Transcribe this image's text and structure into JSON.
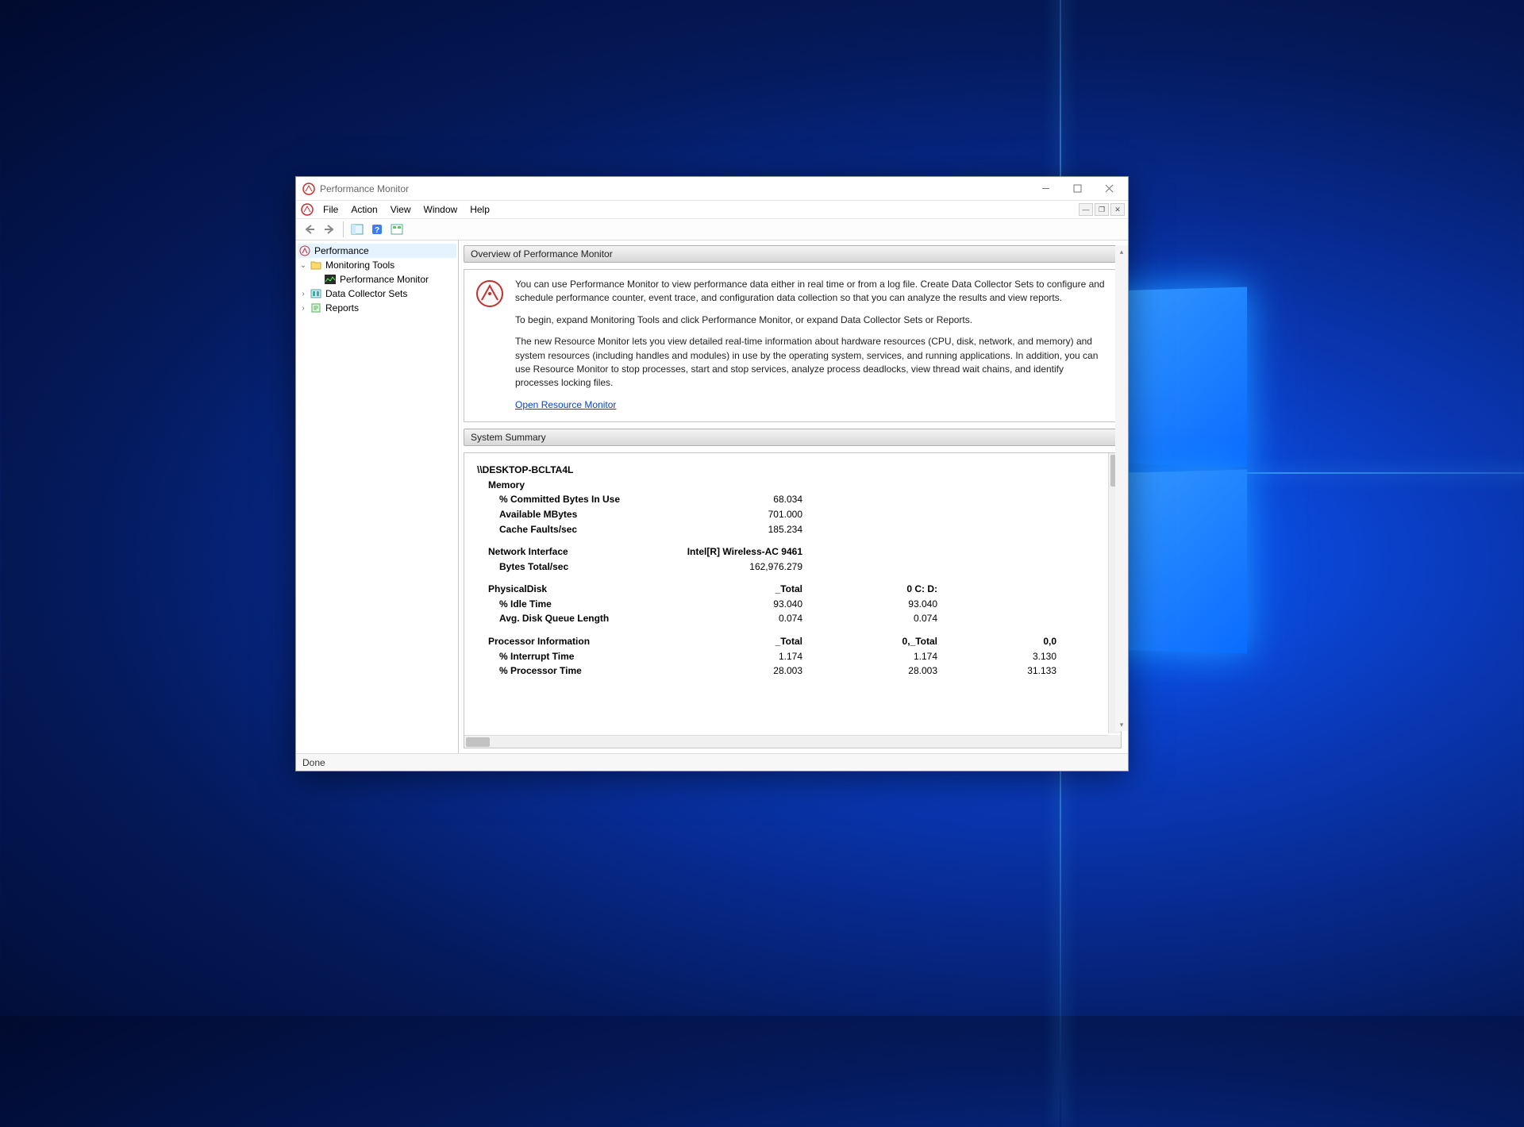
{
  "window": {
    "title": "Performance Monitor"
  },
  "menubar": {
    "items": [
      "File",
      "Action",
      "View",
      "Window",
      "Help"
    ]
  },
  "tree": {
    "root": "Performance",
    "monitoring_tools": "Monitoring Tools",
    "performance_monitor": "Performance Monitor",
    "data_collector_sets": "Data Collector Sets",
    "reports": "Reports"
  },
  "overview": {
    "header": "Overview of Performance Monitor",
    "p1": "You can use Performance Monitor to view performance data either in real time or from a log file. Create Data Collector Sets to configure and schedule performance counter, event trace, and configuration data collection so that you can analyze the results and view reports.",
    "p2": "To begin, expand Monitoring Tools and click Performance Monitor, or expand Data Collector Sets or Reports.",
    "p3": "The new Resource Monitor lets you view detailed real-time information about hardware resources (CPU, disk, network, and memory) and system resources (including handles and modules) in use by the operating system, services, and running applications. In addition, you can use Resource Monitor to stop processes, start and stop services, analyze process deadlocks, view thread wait chains, and identify processes locking files.",
    "link": "Open Resource Monitor"
  },
  "summary": {
    "header": "System Summary",
    "host": "\\\\DESKTOP-BCLTA4L",
    "memory": {
      "label": "Memory",
      "committed_label": "% Committed Bytes In Use",
      "committed_val": "68.034",
      "available_label": "Available MBytes",
      "available_val": "701.000",
      "cache_label": "Cache Faults/sec",
      "cache_val": "185.234"
    },
    "network": {
      "label": "Network Interface",
      "col1": "Intel[R] Wireless-AC 9461",
      "bytes_label": "Bytes Total/sec",
      "bytes_val": "162,976.279"
    },
    "disk": {
      "label": "PhysicalDisk",
      "col1": "_Total",
      "col2": "0 C: D:",
      "idle_label": "% Idle Time",
      "idle_v1": "93.040",
      "idle_v2": "93.040",
      "queue_label": "Avg. Disk Queue Length",
      "queue_v1": "0.074",
      "queue_v2": "0.074"
    },
    "processor": {
      "label": "Processor Information",
      "col1": "_Total",
      "col2": "0,_Total",
      "col3": "0,0",
      "interrupt_label": "% Interrupt Time",
      "interrupt_v1": "1.174",
      "interrupt_v2": "1.174",
      "interrupt_v3": "3.130",
      "proc_label": "% Processor Time",
      "proc_v1": "28.003",
      "proc_v2": "28.003",
      "proc_v3": "31.133"
    }
  },
  "status": "Done"
}
